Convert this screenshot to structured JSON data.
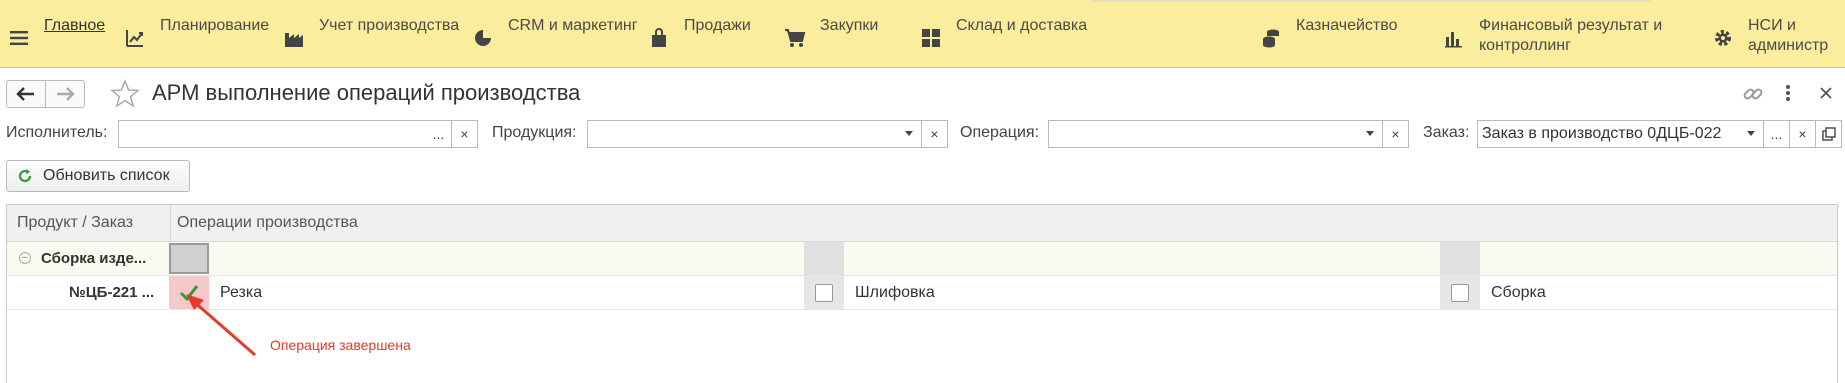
{
  "nav": {
    "items": [
      {
        "label": "Главное",
        "icon": "menu-icon"
      },
      {
        "label": "Планирование",
        "icon": "planning-icon"
      },
      {
        "label": "Учет производства",
        "icon": "factory-icon"
      },
      {
        "label": "CRM и маркетинг",
        "icon": "pie-chart-icon"
      },
      {
        "label": "Продажи",
        "icon": "shopping-bag-icon"
      },
      {
        "label": "Закупки",
        "icon": "cart-icon"
      },
      {
        "label": "Склад и доставка",
        "icon": "warehouse-icon"
      },
      {
        "label": "Казначейство",
        "icon": "coins-icon"
      },
      {
        "label": "Финансовый результат и",
        "label2": "контроллинг",
        "icon": "bar-chart-icon"
      },
      {
        "label": "НСИ и",
        "label2": "администр",
        "icon": "gear-icon"
      }
    ]
  },
  "page": {
    "title": "АРМ выполнение операций производства"
  },
  "filters": {
    "executor_label": "Исполнитель:",
    "executor_value": "",
    "product_label": "Продукция:",
    "product_value": "",
    "operation_label": "Операция:",
    "operation_value": "",
    "order_label": "Заказ:",
    "order_value": "Заказ в производство 0ДЦБ-022",
    "dots": "...",
    "clear": "×"
  },
  "toolbar": {
    "refresh_label": "Обновить список"
  },
  "grid": {
    "col_product": "Продукт / Заказ",
    "col_operations": "Операции производства",
    "group_label": "Сборка изде...",
    "item_label": "№ЦБ-221 ...",
    "operations": [
      {
        "name": "Резка",
        "done": true
      },
      {
        "name": "Шлифовка",
        "done": false
      },
      {
        "name": "Сборка",
        "done": false
      }
    ]
  },
  "annotation": {
    "text": "Операция завершена",
    "color": "#e53a2a"
  },
  "colors": {
    "nav_bg": "#fbed9e",
    "done_bg": "#f5c9c9",
    "check_green": "#2e9a3a"
  }
}
